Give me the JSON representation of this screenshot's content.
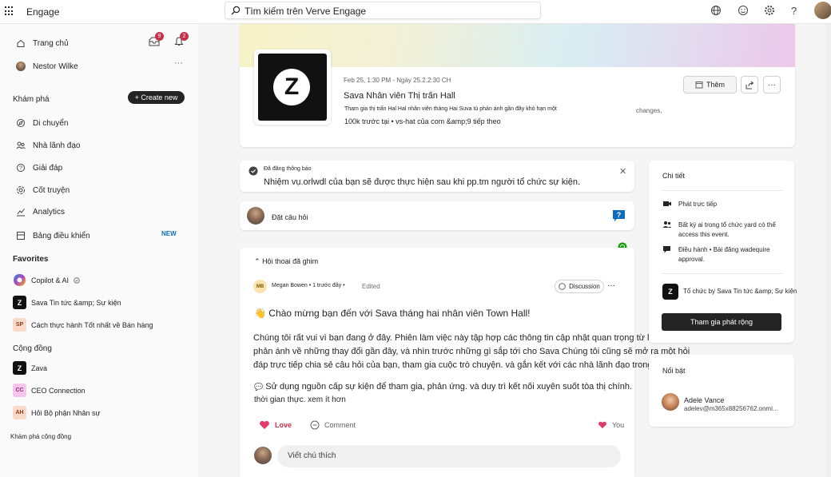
{
  "app": {
    "name": "Engage",
    "search_placeholder": "Tìm kiếm trên Verve Engage"
  },
  "sidebar": {
    "home": "Trang chủ",
    "user": "Nestor Wilke",
    "badges": {
      "inbox": "9",
      "notifications": "2"
    },
    "explore_title": "Khám phá",
    "create_new": "Create new",
    "nav": [
      "Di chuyển",
      "Nhà lãnh đạo",
      "Giải đáp",
      "Cốt truyện",
      "Analytics",
      "Bảng điều khiển"
    ],
    "new_tag": "NEW",
    "favorites_title": "Favorites",
    "favorites": [
      {
        "name": "Copilot & AI",
        "icon": "copilot-icon"
      },
      {
        "name": "Sava Tin tức &amp; Sự kiện",
        "initials": "Z"
      },
      {
        "name": "Cách thực hành Tốt nhất về Bán hàng",
        "initials": "SP"
      }
    ],
    "community_title": "Cộng đồng",
    "communities": [
      {
        "name": "Zava",
        "initials": "Z"
      },
      {
        "name": "CEO Connection",
        "initials": "CC"
      },
      {
        "name": "Hỏi Bộ phận Nhân sự",
        "initials": "AH"
      }
    ],
    "discover_communities": "Khám phá cộng đồng"
  },
  "event": {
    "date": "Feb 25, 1:30 PM - Ngày 25.2.2:30 CH",
    "title": "Sava Nhân viên Thị trấn Hall",
    "desc": "Tham gia thị trấn Hal Hal nhân viên tháng Hai Suva tù phản ánh gần đây khỏ hạn một",
    "desc_tail": "changes,",
    "stats": "100k trước tại • vs-hat của com &amp;9 tiếp theo",
    "add_button": "Thêm"
  },
  "notice": {
    "label": "Đã đăng thông báo",
    "text": "Nhiệm vụ.orlwdl của bạn sẽ được thực hiện sau khi pp.tm người tổ chức sự kiện."
  },
  "ask": {
    "placeholder": "Đặt câu hỏi"
  },
  "post": {
    "pinned": "Hội thoại đã ghim",
    "author_initials": "MB",
    "author": "Megan Bowen • 1 trước đây •",
    "edited": "Edited",
    "discussion": "Discussion",
    "greeting": "Chào mừng bạn đến với Sava tháng hai nhân viên Town Hall!",
    "body": "Chúng tôi rất vui vì bạn đang ở đây. Phiên làm việc này tập hợp các thông tin cập nhật quan trọng từ lãnh đạo, sự phản ánh về những thay đổi gần đây, và nhìn trước những gì sắp tới cho Sava Chúng tôi cũng sẽ mở ra một hỏi đáp trực tiếp chia sẻ câu hỏi của bạn, tham gia cuộc trò chuyện. và gắn kết với các nhà lãnh đạo trong",
    "body2": "Sử dụng nguồn cấp sự kiện để tham gia, phản ứng. và duy trì kết nối xuyên suốt tòa thị chính.",
    "body3": "thời gian thực. xem ít hơn",
    "love": "Love",
    "comment": "Comment",
    "you": "You",
    "write_comment": "Viết chú thích"
  },
  "details": {
    "title": "Chi tiết",
    "items": [
      {
        "icon": "video-icon",
        "text": "Phát trực tiếp"
      },
      {
        "icon": "people-icon",
        "text": "Bất kỳ ai trong tổ chức yard có thể access this event."
      },
      {
        "icon": "moderation-icon",
        "text": "Điều hành • Bài đăng wadequire approval."
      }
    ],
    "organizer": "Tổ chức by Sava Tin tức &amp; Sự kiện",
    "join": "Tham gia phát rộng"
  },
  "featured": {
    "title": "Nổi bật",
    "name": "Adele Vance",
    "email": "adelev@m365x88256762.onmi..."
  },
  "colors": {
    "accent": "#0f6cbd",
    "badge": "#c4314b",
    "love": "#e23b6a"
  }
}
